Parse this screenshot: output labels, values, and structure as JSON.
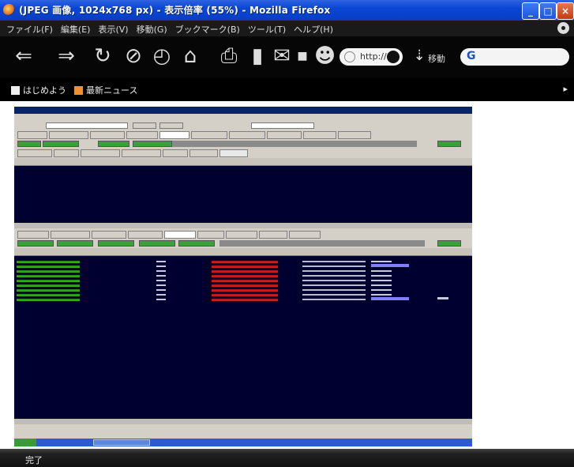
{
  "window": {
    "title": "(JPEG 画像, 1024x768 px) - 表示倍率 (55%) - Mozilla Firefox",
    "controls": {
      "minimize": "_",
      "maximize": "□",
      "close": "×"
    }
  },
  "menu": {
    "items": [
      "ファイル(F)",
      "編集(E)",
      "表示(V)",
      "移動(G)",
      "ブックマーク(B)",
      "ツール(T)",
      "ヘルプ(H)"
    ]
  },
  "toolbar": {
    "url_text": "http://",
    "go_label": "移動",
    "search_letter": "G"
  },
  "bookmarks": {
    "items": [
      {
        "icon": "page-icon",
        "label": "はじめよう"
      },
      {
        "icon": "rss-icon",
        "label": "最新ニュース"
      }
    ]
  },
  "statusbar": {
    "text": "完了"
  },
  "colors": {
    "titlebar": "#0a46d6",
    "inner_background": "#000030",
    "green_text": "#5cff3a",
    "red_text": "#ff2a2a"
  }
}
